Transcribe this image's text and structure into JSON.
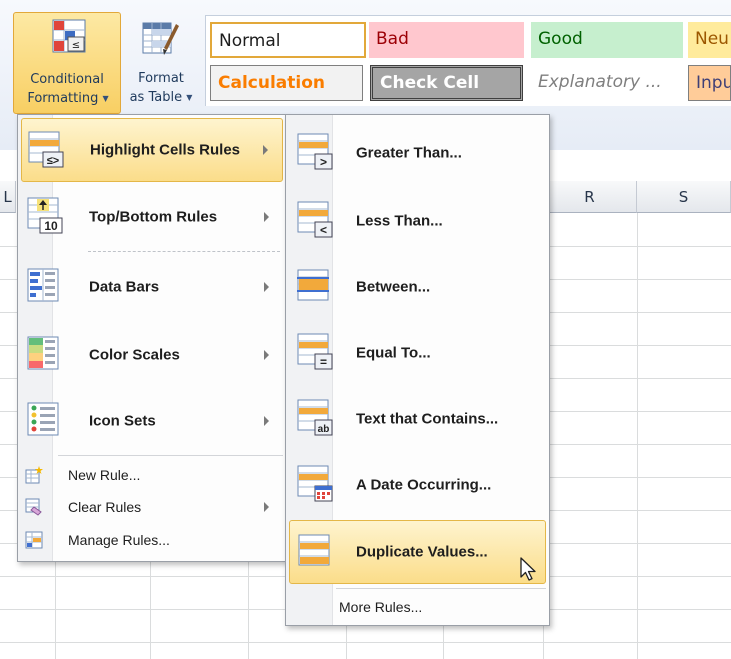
{
  "ribbon": {
    "conditional_formatting": {
      "line1": "Conditional",
      "line2": "Formatting"
    },
    "format_as_table": {
      "line1": "Format",
      "line2": "as Table"
    },
    "styles": [
      {
        "label": "Normal",
        "bg": "#ffffff",
        "fg": "#1e1e1e",
        "border": "#e2a83a"
      },
      {
        "label": "Bad",
        "bg": "#ffc7ce",
        "fg": "#9c0006",
        "border": "#ffc7ce"
      },
      {
        "label": "Good",
        "bg": "#c6efce",
        "fg": "#006100",
        "border": "#c6efce"
      },
      {
        "label": "Neu",
        "bg": "#ffeb9c",
        "fg": "#9c5700",
        "border": "#ffeb9c"
      },
      {
        "label": "Calculation",
        "bg": "#f2f2f2",
        "fg": "#fa7d00",
        "border": "#7f7f7f"
      },
      {
        "label": "Check Cell",
        "bg": "#a5a5a5",
        "fg": "#ffffff",
        "border": "#3f3f3f"
      },
      {
        "label": "Explanatory ...",
        "bg": "#ffffff",
        "fg": "#7f7f7f",
        "border": "#ffffff"
      },
      {
        "label": "Inpu",
        "bg": "#ffcc99",
        "fg": "#3f3f76",
        "border": "#7f7f7f"
      }
    ]
  },
  "sheet": {
    "columns": [
      "R",
      "S"
    ],
    "partial_column": "L"
  },
  "main_menu": {
    "items": [
      {
        "label": "Highlight Cells Rules",
        "icon": "highlight-cells-rules-icon"
      },
      {
        "label": "Top/Bottom Rules",
        "icon": "top-bottom-rules-icon"
      },
      {
        "label": "Data Bars",
        "icon": "data-bars-icon"
      },
      {
        "label": "Color Scales",
        "icon": "color-scales-icon"
      },
      {
        "label": "Icon Sets",
        "icon": "icon-sets-icon"
      },
      {
        "label": "New Rule...",
        "icon": "new-rule-icon"
      },
      {
        "label": "Clear Rules",
        "icon": "clear-rules-icon"
      },
      {
        "label": "Manage Rules...",
        "icon": "manage-rules-icon"
      }
    ]
  },
  "sub_menu": {
    "items": [
      {
        "label": "Greater Than...",
        "icon": "greater-than-icon"
      },
      {
        "label": "Less Than...",
        "icon": "less-than-icon"
      },
      {
        "label": "Between...",
        "icon": "between-icon"
      },
      {
        "label": "Equal To...",
        "icon": "equal-to-icon"
      },
      {
        "label": "Text that Contains...",
        "icon": "text-contains-icon"
      },
      {
        "label": "A Date Occurring...",
        "icon": "date-occurring-icon"
      },
      {
        "label": "Duplicate Values...",
        "icon": "duplicate-values-icon"
      },
      {
        "label": "More Rules...",
        "icon": "more-rules-icon"
      }
    ]
  },
  "colors": {
    "highlight": "#fbdd8a",
    "highlight_border": "#e4b748",
    "menu_border": "#9a9fa7"
  }
}
